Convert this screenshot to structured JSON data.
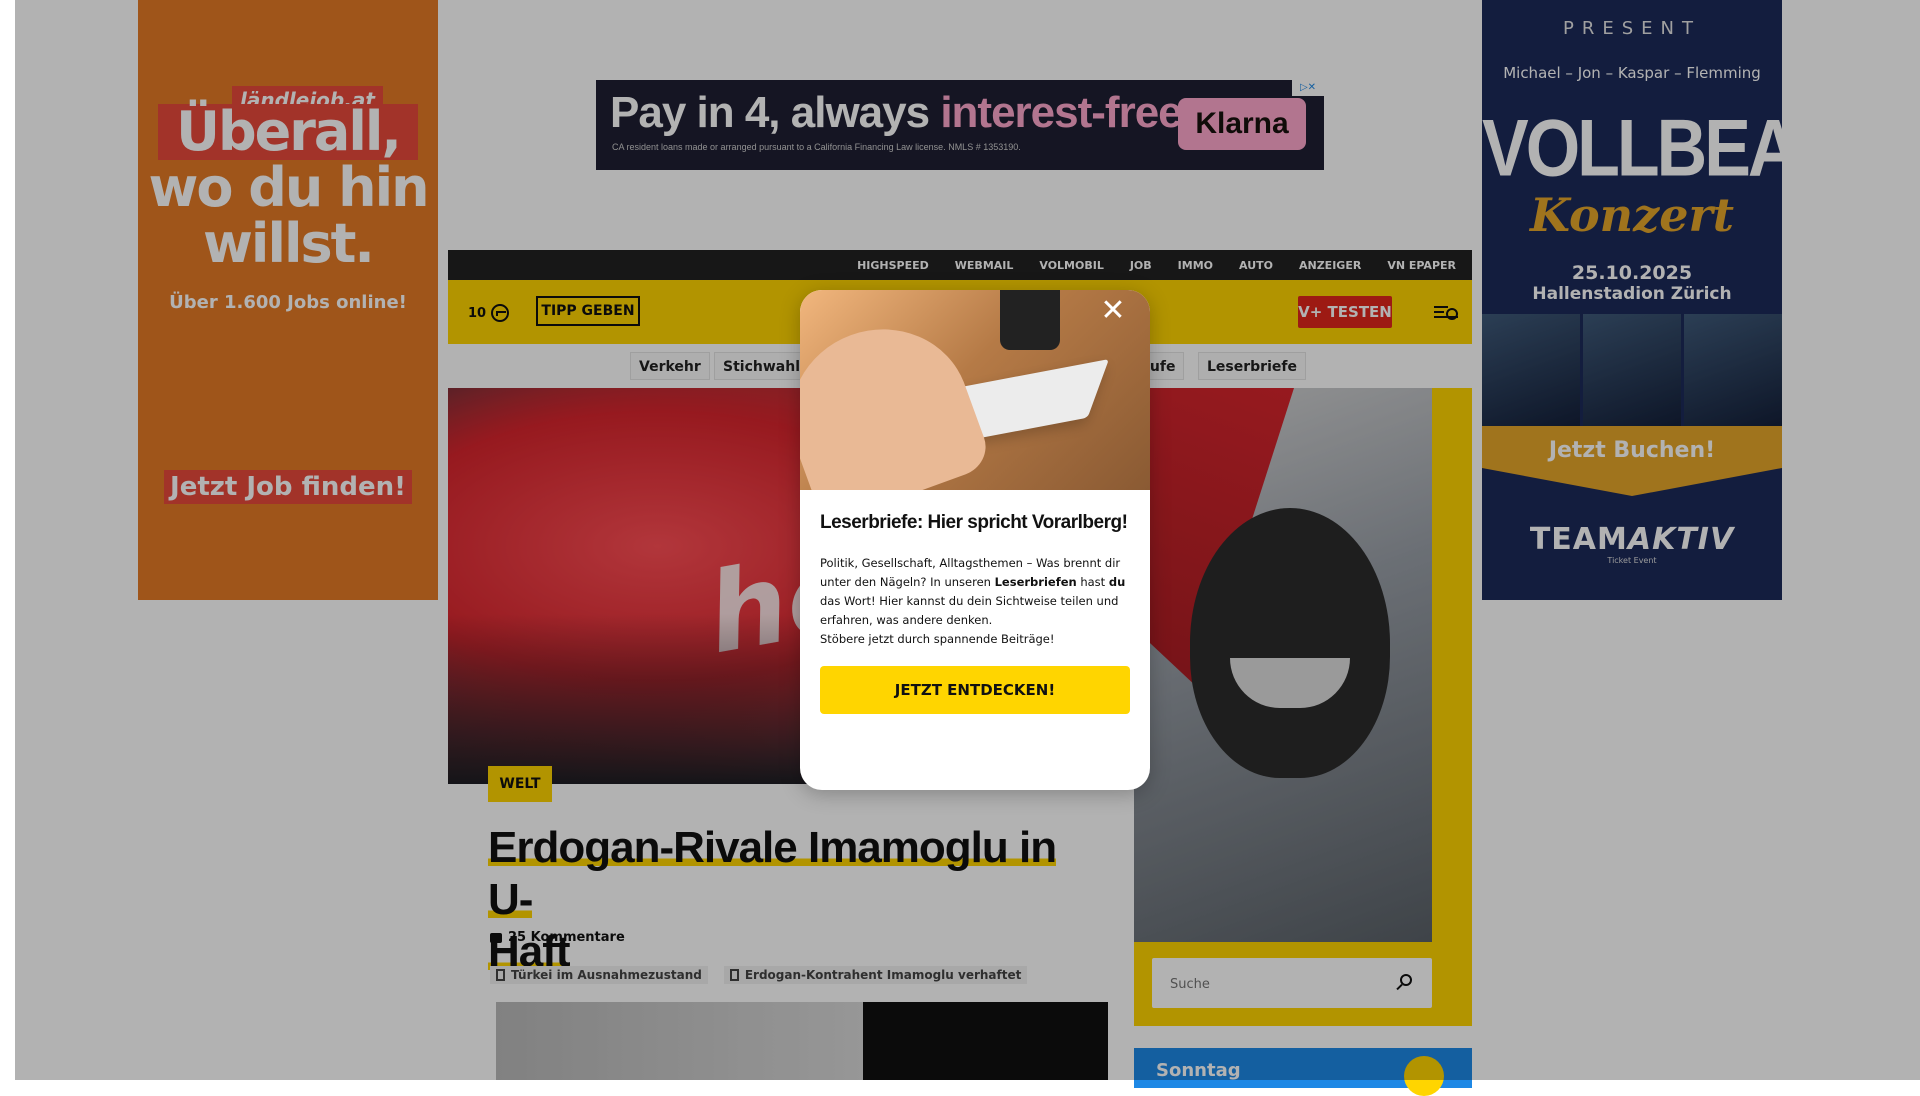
{
  "ads": {
    "left": {
      "brand": "ländlejob.at",
      "headline": [
        "Überall,",
        "wo du hin",
        "willst."
      ],
      "subline": "Über 1.600 Jobs online!",
      "cta": "Jetzt Job finden!"
    },
    "top": {
      "headline_a": "Pay in 4, always ",
      "headline_b": "interest-free",
      "fineprint": "CA resident loans made or arranged pursuant to a California Financing Law license. NMLS # 1353190.",
      "button": "Klarna"
    },
    "right": {
      "present": "PRESENT",
      "names": "Michael – Jon – Kaspar – Flemming",
      "band": "VOLLBEAT",
      "subtitle": "Konzert",
      "date": "25.10.2025",
      "venue": "Hallenstadion Zürich",
      "cta": "Jetzt Buchen!",
      "organizer_a": "TEAM",
      "organizer_b": "AKTIV",
      "organizer_small": "Ticket Event"
    }
  },
  "topnav": [
    "HIGHSPEED",
    "WEBMAIL",
    "VOLMOBIL",
    "JOB",
    "IMMO",
    "AUTO",
    "ANZEIGER",
    "VN EPAPER"
  ],
  "header": {
    "counter": "10",
    "tipp": "TIPP GEBEN",
    "vplus": "V+ TESTEN"
  },
  "chips": [
    {
      "label": "Verkehr",
      "left": 0
    },
    {
      "label": "Stichwahlen",
      "left": 0
    },
    {
      "label": "rufe",
      "left": 0
    },
    {
      "label": "Leserbriefe",
      "left": 0
    }
  ],
  "article": {
    "category": "WELT",
    "headline_line1": "Erdogan-Rivale Imamoglu in U-",
    "headline_line2": "Haft",
    "comments": "25 Kommentare",
    "tags": [
      "Türkei im Ausnahmezustand",
      "Erdogan-Kontrahent Imamoglu verhaftet"
    ],
    "hero_text": "he"
  },
  "sidebar": {
    "search_placeholder": "Suche",
    "weather_label": "Sonntag"
  },
  "modal": {
    "title": "Leserbriefe: Hier spricht Vorarlberg!",
    "body_1": "Politik, Gesellschaft, Alltagsthemen – Was brennt dir unter den Nägeln? In unseren ",
    "body_bold_1": "Leserbriefen",
    "body_2": " hast ",
    "body_bold_2": "du",
    "body_3": " das Wort! Hier kannst du dein Sichtweise teilen und erfahren, was andere denken.",
    "body_4": "Stöbere jetzt durch spannende Beiträge!",
    "button": "JETZT ENTDECKEN!",
    "close": "✕"
  }
}
